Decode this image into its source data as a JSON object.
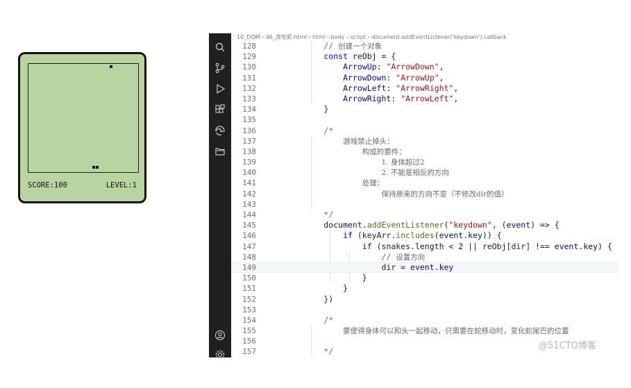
{
  "game": {
    "score_text": "SCORE:100",
    "level_text": "LEVEL:1"
  },
  "editor": {
    "breadcrumb": "10_DOM › 46_贪吃蛇.html › html › body › script › document.addEventListener('keydown') callback",
    "activity_icons": [
      "search-icon",
      "source-control-icon",
      "run-debug-icon",
      "extensions-icon",
      "edge-icon",
      "folder-icon",
      "account-icon",
      "settings-icon"
    ],
    "lines": [
      {
        "n": "128",
        "html": "        <span class=\"cm\">// </span><span class=\"cn\">创建一个对象</span>"
      },
      {
        "n": "129",
        "html": "        <span class=\"kw\">const</span> reObj = {"
      },
      {
        "n": "130",
        "html": "            <span class=\"prop\">ArrowUp</span>: <span class=\"str\">\"ArrowDown\"</span>,"
      },
      {
        "n": "131",
        "html": "            <span class=\"prop\">ArrowDown</span>: <span class=\"str\">\"ArrowUp\"</span>,"
      },
      {
        "n": "132",
        "html": "            <span class=\"prop\">ArrowLeft</span>: <span class=\"str\">\"ArrowRight\"</span>,"
      },
      {
        "n": "133",
        "html": "            <span class=\"prop\">ArrowRight</span>: <span class=\"str\">\"ArrowLeft\"</span>,"
      },
      {
        "n": "134",
        "html": "        }"
      },
      {
        "n": "135",
        "html": ""
      },
      {
        "n": "136",
        "html": "        <span class=\"cm\">/*</span>"
      },
      {
        "n": "137",
        "html": "            <span class=\"cn\">游戏禁止掉头：</span>"
      },
      {
        "n": "138",
        "html": "                <span class=\"cn\">构成的要件：</span>"
      },
      {
        "n": "139",
        "html": "                    <span class=\"cn\">1. 身体超过2</span>"
      },
      {
        "n": "140",
        "html": "                    <span class=\"cn\">2. 不能是相反的方向</span>"
      },
      {
        "n": "141",
        "html": "                <span class=\"cn\">处理：</span>"
      },
      {
        "n": "142",
        "html": "                    <span class=\"cn\">保持原来的方向不变（不修改dir的值）</span>"
      },
      {
        "n": "143",
        "html": ""
      },
      {
        "n": "144",
        "html": "        <span class=\"cm\">*/</span>"
      },
      {
        "n": "145",
        "html": "        document.<span class=\"fn\">addEventListener</span>(<span class=\"str\">\"keydown\"</span>, (<span class=\"prop\">event</span>) <span class=\"kw\">=&gt;</span> {"
      },
      {
        "n": "146",
        "html": "            <span class=\"kw\">if</span> (keyArr.<span class=\"fn\">includes</span>(<span class=\"prop\">event</span>.<span class=\"prop\">key</span>)) {"
      },
      {
        "n": "147",
        "html": "                <span class=\"kw\">if</span> (snakes.length &lt; <span class=\"kw\">2</span> || reObj[dir] !== <span class=\"prop\">event</span>.<span class=\"prop\">key</span>) {"
      },
      {
        "n": "148",
        "html": "                    <span class=\"cm\">// </span><span class=\"cn\">设置方向</span>"
      },
      {
        "n": "149",
        "html": "                    dir = <span class=\"prop\">event</span>.<span class=\"prop\">key</span>"
      },
      {
        "n": "150",
        "html": "                }"
      },
      {
        "n": "151",
        "html": "            }"
      },
      {
        "n": "152",
        "html": "        })"
      },
      {
        "n": "153",
        "html": ""
      },
      {
        "n": "154",
        "html": "        <span class=\"cm\">/*</span>"
      },
      {
        "n": "155",
        "html": "            <span class=\"cn\">要使得身体可以和头一起移动，只需要在蛇移动时，变化蛇尾巴的位置</span>"
      },
      {
        "n": "156",
        "html": ""
      },
      {
        "n": "157",
        "html": "        <span class=\"cm\">*/</span>"
      }
    ],
    "active_line": "149"
  },
  "watermark": "@51CTO博客"
}
